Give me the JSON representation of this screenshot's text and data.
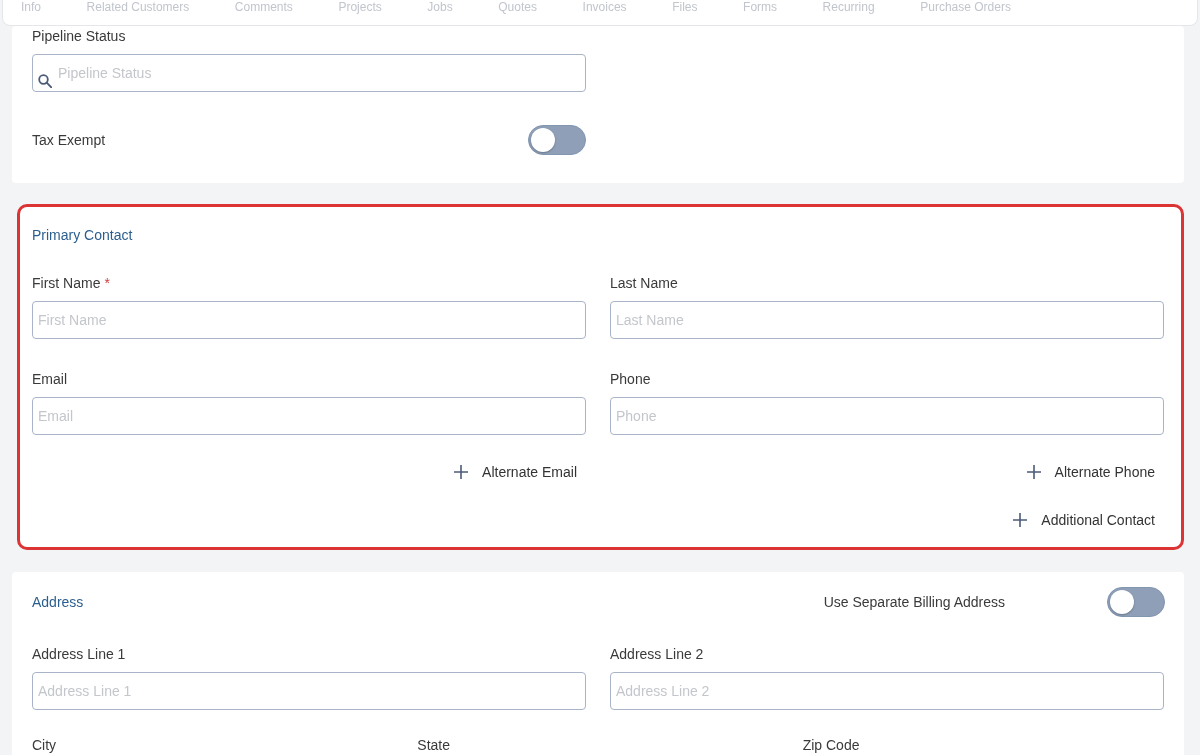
{
  "tabs": [
    {
      "label": "Info"
    },
    {
      "label": "Related Customers"
    },
    {
      "label": "Comments"
    },
    {
      "label": "Projects"
    },
    {
      "label": "Jobs"
    },
    {
      "label": "Quotes"
    },
    {
      "label": "Invoices"
    },
    {
      "label": "Files"
    },
    {
      "label": "Forms"
    },
    {
      "label": "Recurring"
    },
    {
      "label": "Purchase Orders"
    }
  ],
  "details": {
    "pipeline_status": {
      "label": "Pipeline Status",
      "placeholder": "Pipeline Status"
    },
    "tax_exempt": {
      "label": "Tax Exempt",
      "on": false
    }
  },
  "primary_contact": {
    "title": "Primary Contact",
    "highlighted": true,
    "fields": [
      {
        "label": "First Name",
        "required_mark": "*",
        "placeholder": "First Name"
      },
      {
        "label": "Last Name",
        "placeholder": "Last Name"
      },
      {
        "label": "Email",
        "placeholder": "Email"
      },
      {
        "label": "Phone",
        "placeholder": "Phone"
      }
    ],
    "add_buttons": [
      "Alternate Email",
      "Alternate Phone"
    ],
    "additional_contact": "Additional Contact"
  },
  "address": {
    "title": "Address",
    "separate_billing": {
      "label": "Use Separate Billing Address",
      "on": false
    },
    "fields": [
      {
        "label": "Address Line 1",
        "placeholder": "Address Line 1"
      },
      {
        "label": "Address Line 2",
        "placeholder": "Address Line 2"
      }
    ],
    "next_labels": [
      "City",
      "State",
      "Zip Code"
    ]
  }
}
